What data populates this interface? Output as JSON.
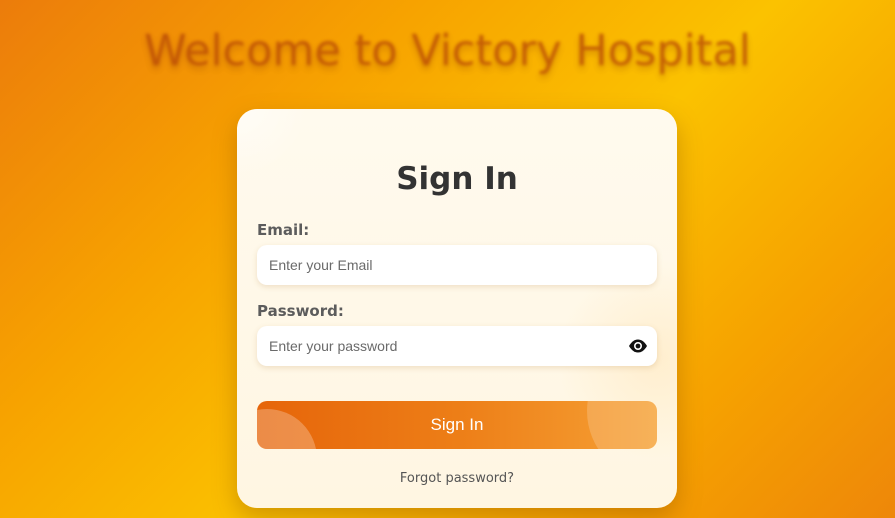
{
  "page": {
    "headline": "Welcome to Victory Hospital"
  },
  "login": {
    "title": "Sign In",
    "email_label": "Email:",
    "email_placeholder": "Enter your Email",
    "email_value": "",
    "password_label": "Password:",
    "password_placeholder": "Enter your password",
    "password_value": "",
    "submit_label": "Sign In",
    "forgot_label": "Forgot password?"
  },
  "icons": {
    "password_toggle": "eye-icon"
  },
  "colors": {
    "background_start": "#ec7c0b",
    "background_mid": "#fbc200",
    "accent": "#e6650a",
    "card": "#fffaee"
  }
}
